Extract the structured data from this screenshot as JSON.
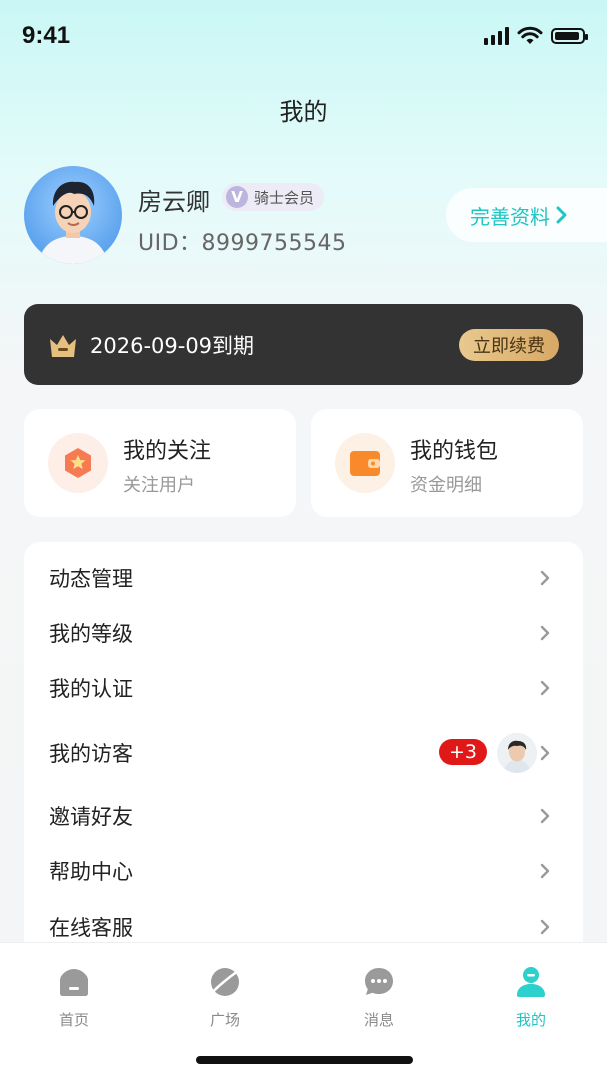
{
  "status_bar": {
    "time": "9:41"
  },
  "header": {
    "title": "我的"
  },
  "profile": {
    "name": "房云卿",
    "vip_mark": "V",
    "vip_label": "骑士会员",
    "uid": "UID：8999755545",
    "complete_button": "完善资料"
  },
  "membership": {
    "expire_text": "2026-09-09到期",
    "renew_button": "立即续费"
  },
  "quick_cards": [
    {
      "title": "我的关注",
      "subtitle": "关注用户",
      "icon": "star-icon"
    },
    {
      "title": "我的钱包",
      "subtitle": "资金明细",
      "icon": "wallet-icon"
    }
  ],
  "menu": [
    {
      "label": "动态管理"
    },
    {
      "label": "我的等级"
    },
    {
      "label": "我的认证"
    },
    {
      "label": "我的访客",
      "badge": "+3"
    },
    {
      "label": "邀请好友"
    },
    {
      "label": "帮助中心"
    },
    {
      "label": "在线客服"
    }
  ],
  "tabbar": [
    {
      "label": "首页",
      "icon": "home-icon"
    },
    {
      "label": "广场",
      "icon": "planet-icon"
    },
    {
      "label": "消息",
      "icon": "message-icon"
    },
    {
      "label": "我的",
      "icon": "profile-icon",
      "active": true
    }
  ],
  "colors": {
    "accent": "#1fc4c4",
    "member_bg": "#333333",
    "badge_red": "#e11818",
    "gold": "#e2bd80"
  }
}
